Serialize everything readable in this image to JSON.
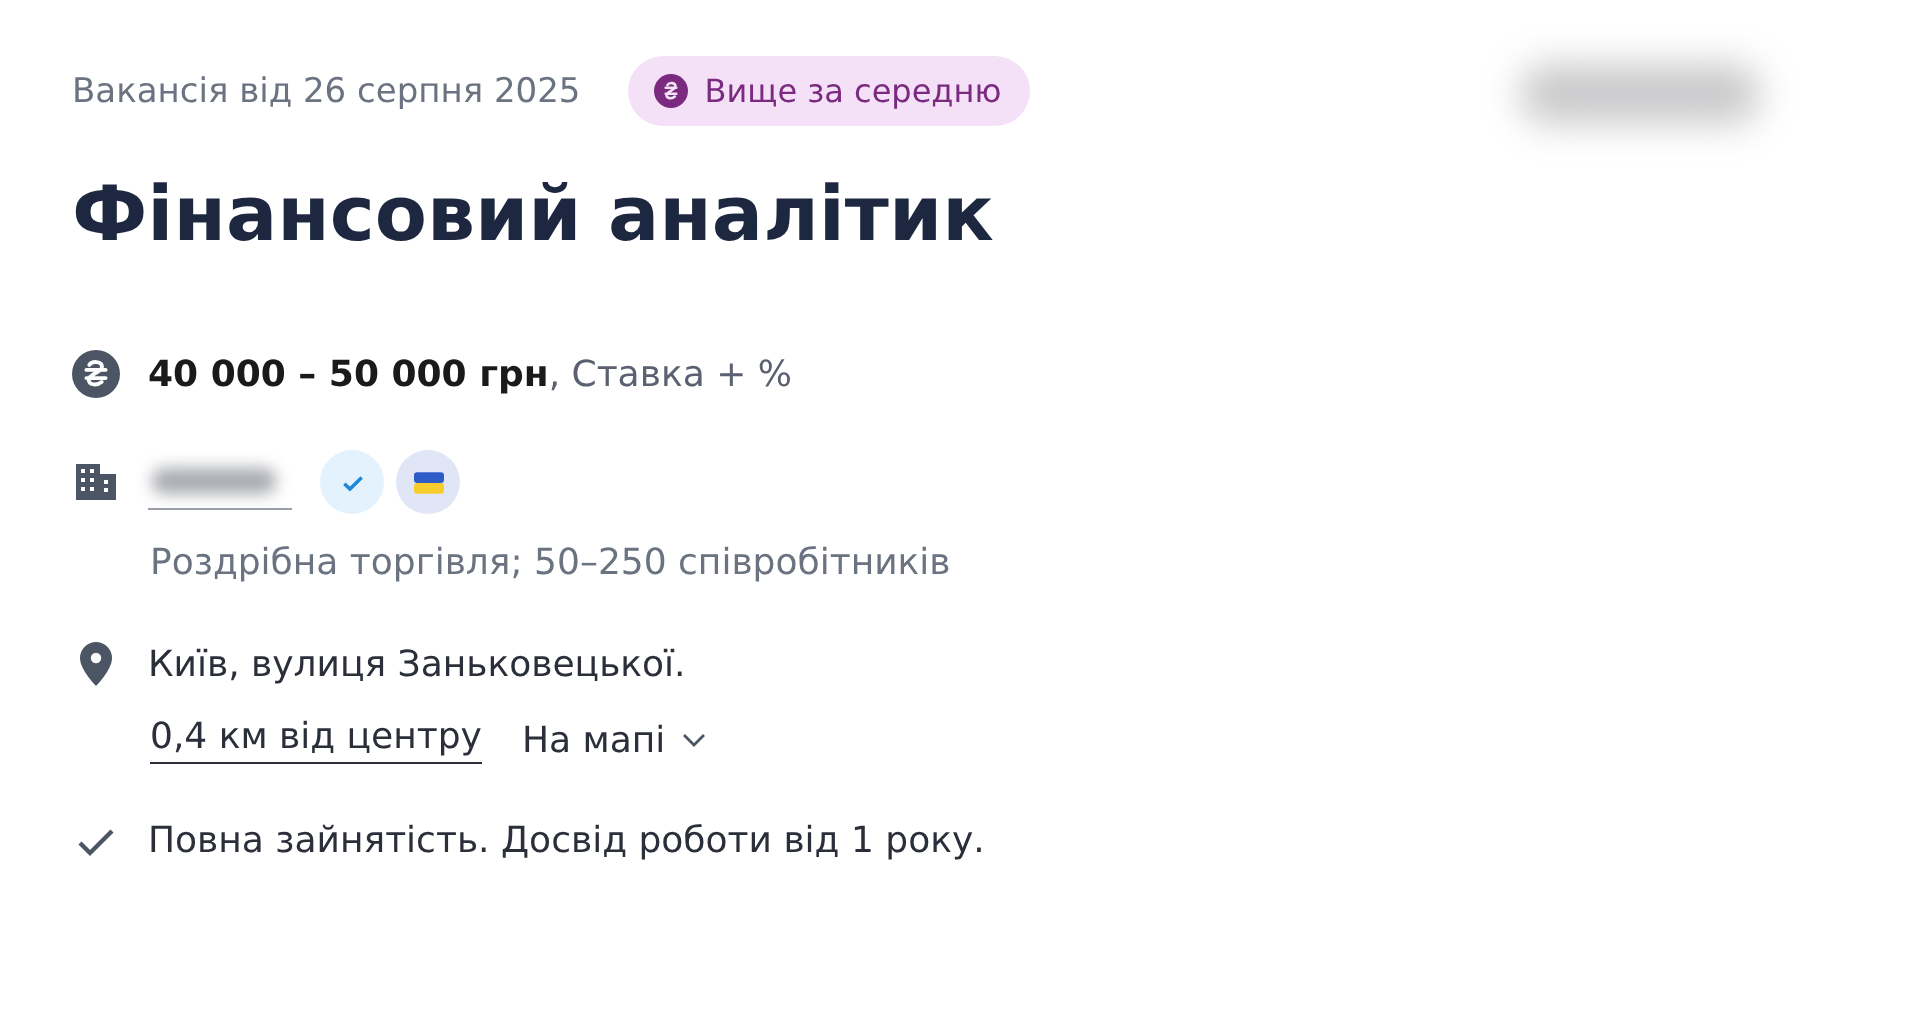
{
  "posted": "Вакансія від 26 серпня 2025",
  "salary_badge": {
    "label": "Вище за середню"
  },
  "title": "Фінансовий аналітик",
  "salary": "**40 000 – 50 000 грн**, Ставка + %",
  "company": {
    "verified": true,
    "flag_badge": true,
    "details": "Роздрібна торгівля; 50–250 співробітників"
  },
  "location": {
    "address": "Київ, вулиця Заньковецької.",
    "distance": "0,4 км від центру",
    "map_toggle": "На мапі",
    "expanded": false
  },
  "conditions": "Повна зайнятість. Досвід роботи від 1 року."
}
